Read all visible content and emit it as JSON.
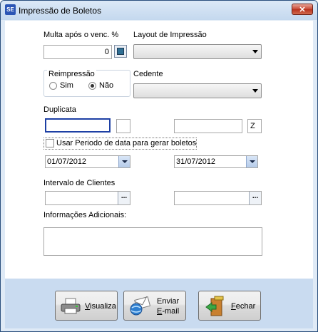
{
  "window": {
    "icon_text": "SE",
    "title": "Impressão de Boletos",
    "close_symbol": "✕"
  },
  "multa": {
    "label": "Multa após o venc. %",
    "value": "0"
  },
  "layout": {
    "label": "Layout de Impressão",
    "selected": ""
  },
  "reimpressao": {
    "legend": "Reimpressão",
    "option_sim": "Sim",
    "option_nao": "Não",
    "selected": "Não"
  },
  "cedente": {
    "label": "Cedente",
    "selected": ""
  },
  "duplicata": {
    "label": "Duplicata",
    "inicio": "",
    "inicio_suffix": "",
    "fim": "",
    "fim_suffix": "Z"
  },
  "usar_periodo": {
    "label": "Usar Periodo de data para gerar boletos",
    "checked": false
  },
  "periodo": {
    "inicio": "01/07/2012",
    "fim": "31/07/2012"
  },
  "clientes": {
    "label": "Intervalo de Clientes",
    "inicio": "",
    "fim": "",
    "button_label": "..."
  },
  "informacoes": {
    "label": "Informações Adicionais:",
    "value": ""
  },
  "buttons": {
    "visualiza": {
      "mnemonic": "V",
      "rest": "isualiza"
    },
    "enviar": {
      "line1": "Enviar",
      "mnemonic": "E",
      "rest": "-mail"
    },
    "fechar": {
      "mnemonic": "F",
      "rest": "echar"
    }
  }
}
